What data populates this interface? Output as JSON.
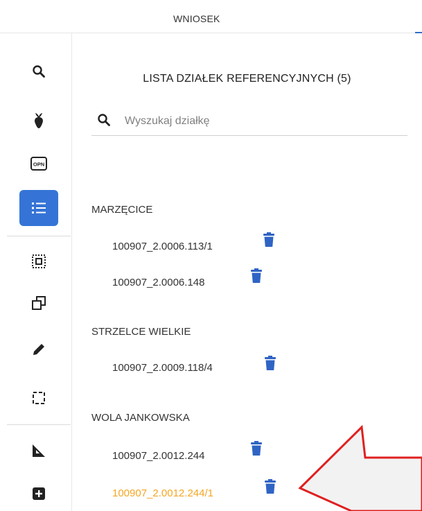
{
  "header": {
    "tab_label": "WNIOSEK"
  },
  "sidebar": {
    "items": [
      {
        "name": "search-icon"
      },
      {
        "name": "crop-icon"
      },
      {
        "name": "opn-icon",
        "label": "OPN"
      },
      {
        "name": "list-icon",
        "active": true
      },
      {
        "name": "select-area-icon"
      },
      {
        "name": "copy-icon"
      },
      {
        "name": "pencil-icon"
      },
      {
        "name": "dashed-rectangle-icon"
      },
      {
        "name": "ruler-icon"
      },
      {
        "name": "add-icon"
      }
    ]
  },
  "panel": {
    "title": "LISTA DZIAŁEK REFERENCYJNYCH (5)",
    "search_placeholder": "Wyszukaj działkę",
    "groups": [
      {
        "name": "MARZĘCICE",
        "parcels": [
          "100907_2.0006.113/1",
          "100907_2.0006.148"
        ]
      },
      {
        "name": "STRZELCE WIELKIE",
        "parcels": [
          "100907_2.0009.118/4"
        ]
      },
      {
        "name": "WOLA JANKOWSKA",
        "parcels": [
          "100907_2.0012.244",
          "100907_2.0012.244/1"
        ]
      }
    ],
    "highlighted_parcel": "100907_2.0012.244/1"
  },
  "colors": {
    "accent": "#3574d6",
    "trash": "#2f64c4",
    "highlight": "#f5a623",
    "callout_border": "#e02020",
    "callout_fill": "#f2f2f2"
  }
}
